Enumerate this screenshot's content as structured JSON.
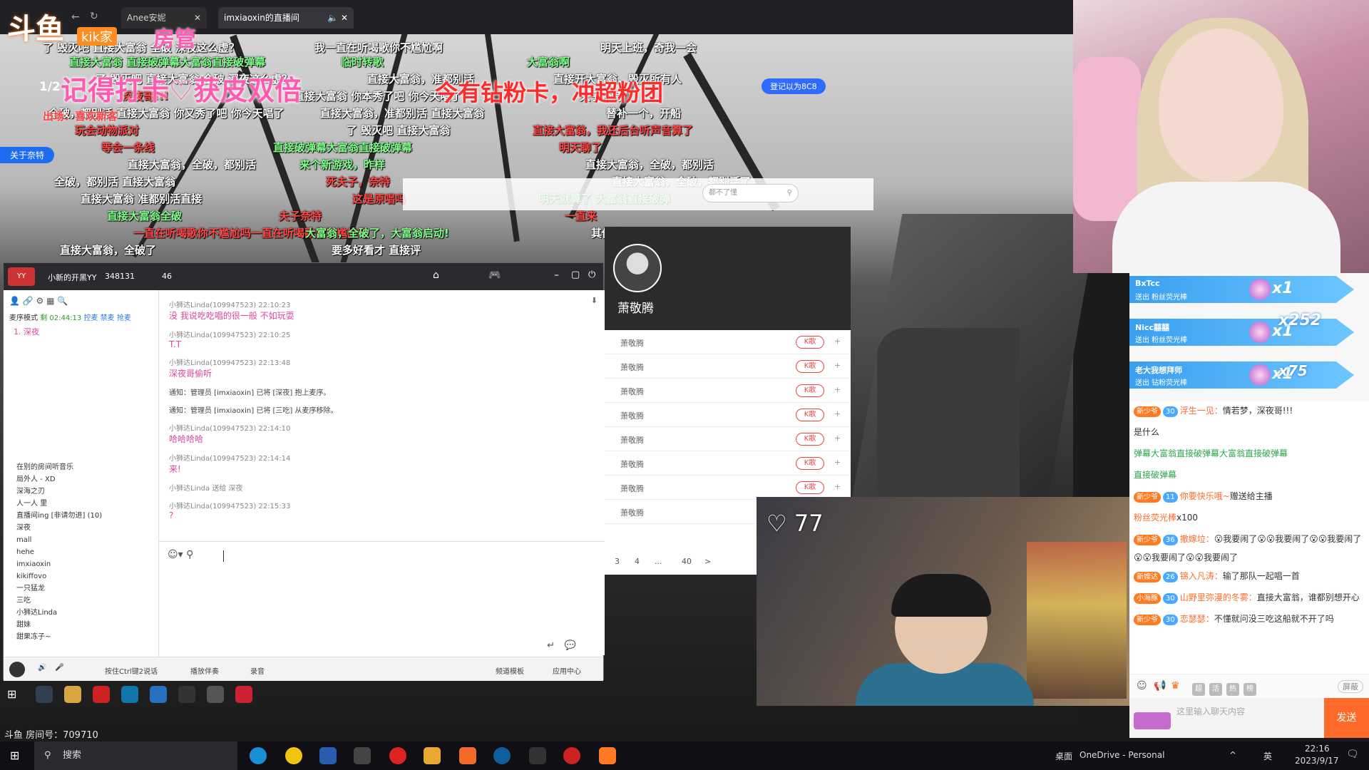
{
  "browser": {
    "tab1_label": "Anee安妮",
    "tab2_label": "imxiaoxin的直播间"
  },
  "overlay": {
    "logo_text": "斗鱼",
    "logo_sub_a": "kik家",
    "logo_sub_b": "房管",
    "big_banner_left": "记得打卡♡获皮双倍",
    "big_banner_mid": "今有钻粉卡，冲超粉团",
    "level_badge": "1/2",
    "guard_chip": "登记以为8C8",
    "tag_left": "关于奈特",
    "tag_red": "出场：喜欢新客",
    "room_number": "斗鱼 房间号：709710"
  },
  "danmaku": [
    {
      "t": "了 毁灭吧  直接大富翁  全破  深夜这么虚？",
      "c": "c-w"
    },
    {
      "t": "直接大富翁  直接破弹幕大富翁直接破弹幕",
      "c": "c-g"
    },
    {
      "t": "了 毁灭吧  直接大富翁  全破  深夜这么虚？",
      "c": "c-w"
    },
    {
      "t": "深夜哥!!!",
      "c": "c-r"
    },
    {
      "t": "全破，都别活 直接大富翁 你又秀了吧 你今天唱了",
      "c": "c-w"
    },
    {
      "t": "玩会动物派对",
      "c": "c-r"
    },
    {
      "t": "等会一条线",
      "c": "c-r"
    },
    {
      "t": "直接大富翁，全破，都别活",
      "c": "c-w"
    },
    {
      "t": "全破，都别活 直接大富翁",
      "c": "c-w"
    },
    {
      "t": "直接大富翁  准都别活直接",
      "c": "c-w"
    },
    {
      "t": "直接大富翁全破",
      "c": "c-g"
    },
    {
      "t": "一直在听喝歌你不尴尬吗一直在听喝歌你不尴尬吗",
      "c": "c-r"
    },
    {
      "t": "直接大富翁，全破了",
      "c": "c-w"
    },
    {
      "t": "我一直在听喝歌你不尴尬啊",
      "c": "c-w"
    },
    {
      "t": "临时转歌",
      "c": "c-g"
    },
    {
      "t": "直接大富翁，准都别活",
      "c": "c-w"
    },
    {
      "t": "直接大富翁  你本秀了吧  你今天唱了",
      "c": "c-w"
    },
    {
      "t": "直接大富翁，准都别活 直接大富翁",
      "c": "c-w"
    },
    {
      "t": "了 毁灭吧 直接大富翁",
      "c": "c-w"
    },
    {
      "t": "直接破弹幕大富翁直接破弹幕",
      "c": "c-g"
    },
    {
      "t": "来个新游戏，昨样",
      "c": "c-g"
    },
    {
      "t": "死夫子，奈特",
      "c": "c-r"
    },
    {
      "t": "这是原唱吗",
      "c": "c-r"
    },
    {
      "t": "夫子奈特",
      "c": "c-r"
    },
    {
      "t": "大富翁，全破了，大富翁启动!",
      "c": "c-g"
    },
    {
      "t": "要多好看才  直接评",
      "c": "c-w"
    },
    {
      "t": "明天上班，奇我一会",
      "c": "c-w"
    },
    {
      "t": "大富翁啊",
      "c": "c-g"
    },
    {
      "t": "直接开大富翁，毁灭所有人",
      "c": "c-w"
    },
    {
      "t": "夫子奈特",
      "c": "c-w"
    },
    {
      "t": "替补一个，开船",
      "c": "c-w"
    },
    {
      "t": "直接大富翁，我还后台听声音算了",
      "c": "c-r"
    },
    {
      "t": "明天聊了",
      "c": "c-r"
    },
    {
      "t": "直接大富翁，全破，都别活",
      "c": "c-w"
    },
    {
      "t": "直接大富翁，全破，都别活了",
      "c": "c-w"
    },
    {
      "t": "明天就算了  大富翁直接破弹",
      "c": "c-g"
    },
    {
      "t": "一直来",
      "c": "c-r"
    },
    {
      "t": "其他歌单，你听得吗",
      "c": "c-w"
    }
  ],
  "yy": {
    "title": "小新的开黑YY",
    "room_id": "348131",
    "online": "46",
    "mode_label": "麦序模式",
    "timer": "剩 02:44:13",
    "ctrl_a": "控麦",
    "ctrl_b": "禁麦",
    "ctrl_c": "抢麦",
    "first_user": "1. 深夜",
    "chat": [
      {
        "head": "小狮达Linda(109947523)  22:10:23",
        "body": "没 我说吃吃唱的很一般 不如玩耍"
      },
      {
        "head": "小狮达Linda(109947523)  22:10:25",
        "body": "T.T"
      },
      {
        "head": "小狮达Linda(109947523)  22:13:48",
        "body": "深夜哥偷听"
      },
      {
        "head": "通知：管理员 [imxiaoxin] 已将 [深夜] 抱上麦序。",
        "body": ""
      },
      {
        "head": "通知：管理员 [imxiaoxin] 已将 [三吃] 从麦序移除。",
        "body": ""
      },
      {
        "head": "小狮达Linda(109947523)  22:14:10",
        "body": "哈哈哈哈"
      },
      {
        "head": "小狮达Linda(109947523)  22:14:14",
        "body": "来!"
      },
      {
        "head": "小狮达Linda 送给 深夜",
        "body": ""
      },
      {
        "head": "小狮达Linda(109947523)  22:15:33",
        "body": "?"
      }
    ],
    "users": [
      "在别的房间听音乐",
      "局外人 - XD",
      "深海之刃",
      "人一人   里",
      "直播间ing [非请勿进] (10)",
      "深夜",
      "mall",
      "hehe",
      "imxiaoxin",
      "kikiffovo",
      "一只猛龙",
      "三吃",
      "小狮达Linda",
      "甜妹",
      "甜果冻子~"
    ],
    "bottom_a": "按住Ctrl键2说话",
    "bottom_b": "播放伴奏",
    "bottom_c": "录音",
    "bottom_d": "频道模板",
    "bottom_e": "应用中心"
  },
  "music": {
    "singer": "萧敬腾",
    "search_placeholder": "都不了懂",
    "song_names": [
      "萧敬腾",
      "萧敬腾",
      "萧敬腾",
      "萧敬腾",
      "萧敬腾",
      "萧敬腾",
      "萧敬腾",
      "萧敬腾"
    ],
    "k_label": "K歌",
    "pager": [
      "3",
      "4",
      "...",
      "40",
      ">"
    ]
  },
  "cam2": {
    "heart_count": "77"
  },
  "gifts": [
    {
      "name": "BxTcc",
      "desc": "送出  粉丝荧光棒",
      "x": "x1"
    },
    {
      "name": "Nicc囍囍",
      "desc": "送出  粉丝荧光棒",
      "x": "x1"
    },
    {
      "name": "老大我想拜师",
      "desc": "送出  钻粉荧光棒",
      "x": "x1"
    }
  ],
  "gift_combo_a": "x252",
  "gift_combo_b": "x75",
  "chat": [
    {
      "badge": "新少爷",
      "lvl": "30",
      "nick": "浮生一见：",
      "text": "情若梦，深夜哥!!!"
    },
    {
      "badge": "",
      "lvl": "",
      "nick": "",
      "text": "是什么"
    },
    {
      "badge": "",
      "lvl": "",
      "nick": "",
      "text": "弹幕大富翁直接破弹幕大富翁直接破弹幕"
    },
    {
      "badge": "",
      "lvl": "",
      "nick": "",
      "text": "直接破弹幕"
    },
    {
      "badge": "新少爷",
      "lvl": "11",
      "nick": "你要快乐哦~",
      "text": "赠送给主播"
    },
    {
      "badge": "",
      "lvl": "",
      "nick": "粉丝荧光棒",
      "text": "x100"
    },
    {
      "badge": "新少爷",
      "lvl": "36",
      "nick": "撤嫁垃：",
      "text": "😮我要闹了😮😮我要闹了😮😮我要闹了😮😮我要闹了😮😮我要闹了"
    },
    {
      "badge": "新嫂达",
      "lvl": "26",
      "nick": "锦入凡涛：",
      "text": "输了那队一起唱一首"
    },
    {
      "badge": "小海豚",
      "lvl": "30",
      "nick": "山野里弥漫的冬雾：",
      "text": "直接大富翁，谁都别想开心"
    },
    {
      "badge": "新少爷",
      "lvl": "30",
      "nick": "恋瑟瑟：",
      "text": "不懂就问没三吃这船就不开了吗"
    }
  ],
  "chat_toolbar": [
    "超",
    "活",
    "热",
    "榜"
  ],
  "chat_shield": "屏蔽",
  "chat_input_placeholder": "这里输入聊天内容",
  "send_label": "发送",
  "taskbar": {
    "search_label": "搜索",
    "desktop": "桌面",
    "onedrive": "OneDrive - Personal",
    "ime": "英",
    "time": "22:16",
    "date": "2023/9/17"
  }
}
